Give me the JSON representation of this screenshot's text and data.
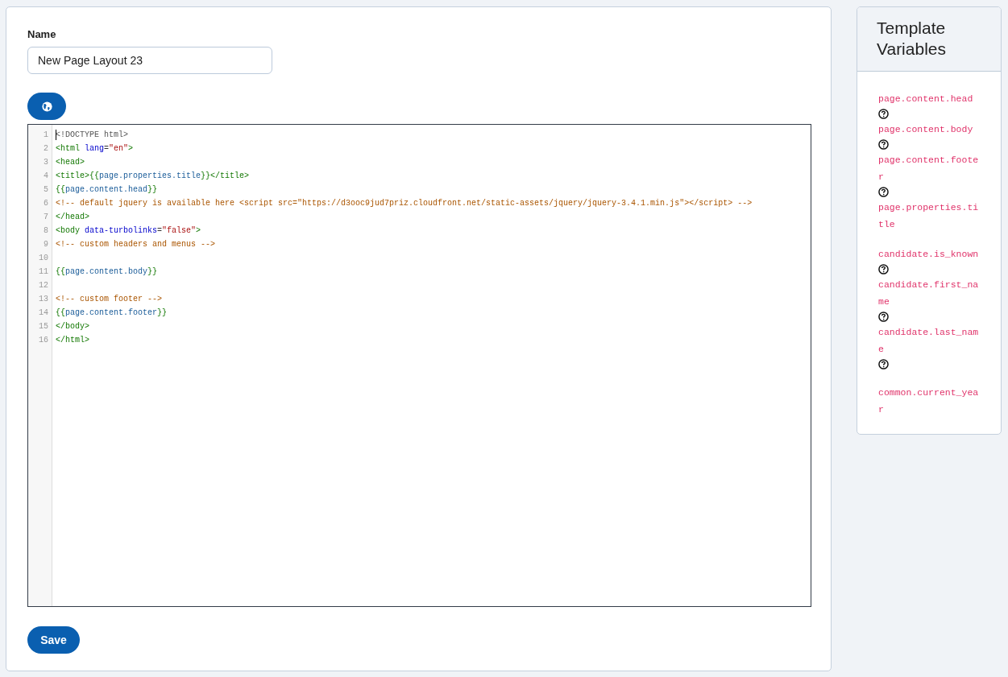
{
  "name_field": {
    "label": "Name",
    "value": "New Page Layout 23"
  },
  "editor": {
    "lines": [
      {
        "number": "1",
        "tokens": [
          {
            "kind": "meta",
            "text": "<!DOCTYPE html>"
          }
        ]
      },
      {
        "number": "2",
        "tokens": [
          {
            "kind": "tag",
            "text": "<html "
          },
          {
            "kind": "attr",
            "text": "lang"
          },
          {
            "kind": "plain",
            "text": "="
          },
          {
            "kind": "string",
            "text": "\"en\""
          },
          {
            "kind": "tag",
            "text": ">"
          }
        ]
      },
      {
        "number": "3",
        "tokens": [
          {
            "kind": "tag",
            "text": "<head>"
          }
        ]
      },
      {
        "number": "4",
        "tokens": [
          {
            "kind": "tag",
            "text": "<title>"
          },
          {
            "kind": "brace",
            "text": "{{"
          },
          {
            "kind": "var",
            "text": "page.properties.title"
          },
          {
            "kind": "brace",
            "text": "}}"
          },
          {
            "kind": "tag",
            "text": "</title>"
          }
        ]
      },
      {
        "number": "5",
        "tokens": [
          {
            "kind": "brace",
            "text": "{{"
          },
          {
            "kind": "var",
            "text": "page.content.head"
          },
          {
            "kind": "brace",
            "text": "}}"
          }
        ]
      },
      {
        "number": "6",
        "tokens": [
          {
            "kind": "comment",
            "text": "<!-- default jquery is available here <script src=\"https://d3ooc9jud7priz.cloudfront.net/static-assets/jquery/jquery-3.4.1.min.js\"></script> -->"
          }
        ]
      },
      {
        "number": "7",
        "tokens": [
          {
            "kind": "tag",
            "text": "</head>"
          }
        ]
      },
      {
        "number": "8",
        "tokens": [
          {
            "kind": "tag",
            "text": "<body "
          },
          {
            "kind": "attr",
            "text": "data-turbolinks"
          },
          {
            "kind": "plain",
            "text": "="
          },
          {
            "kind": "string",
            "text": "\"false\""
          },
          {
            "kind": "tag",
            "text": ">"
          }
        ]
      },
      {
        "number": "9",
        "tokens": [
          {
            "kind": "comment",
            "text": "<!-- custom headers and menus -->"
          }
        ]
      },
      {
        "number": "10"
      },
      {
        "number": "11",
        "tokens": [
          {
            "kind": "brace",
            "text": "{{"
          },
          {
            "kind": "var",
            "text": "page.content.body"
          },
          {
            "kind": "brace",
            "text": "}}"
          }
        ]
      },
      {
        "number": "12"
      },
      {
        "number": "13",
        "tokens": [
          {
            "kind": "comment",
            "text": "<!-- custom footer -->"
          }
        ]
      },
      {
        "number": "14",
        "tokens": [
          {
            "kind": "brace",
            "text": "{{"
          },
          {
            "kind": "var",
            "text": "page.content.footer"
          },
          {
            "kind": "brace",
            "text": "}}"
          }
        ]
      },
      {
        "number": "15",
        "tokens": [
          {
            "kind": "tag",
            "text": "</body>"
          }
        ]
      },
      {
        "number": "16",
        "tokens": [
          {
            "kind": "tag",
            "text": "</html>"
          }
        ]
      }
    ]
  },
  "save_button": "Save",
  "template_variables": {
    "title": "Template Variables",
    "items": [
      {
        "name": "page.content.head",
        "has_help": true,
        "spaced": false
      },
      {
        "name": "page.content.body",
        "has_help": true,
        "spaced": false
      },
      {
        "name": "page.content.footer",
        "has_help": true,
        "spaced": false
      },
      {
        "name": "page.properties.title",
        "has_help": false,
        "spaced": false
      },
      {
        "name": "candidate.is_known",
        "has_help": true,
        "spaced": true
      },
      {
        "name": "candidate.first_name",
        "has_help": true,
        "spaced": false
      },
      {
        "name": "candidate.last_name",
        "has_help": true,
        "spaced": false
      },
      {
        "name": "common.current_year",
        "has_help": false,
        "spaced": true
      }
    ]
  }
}
